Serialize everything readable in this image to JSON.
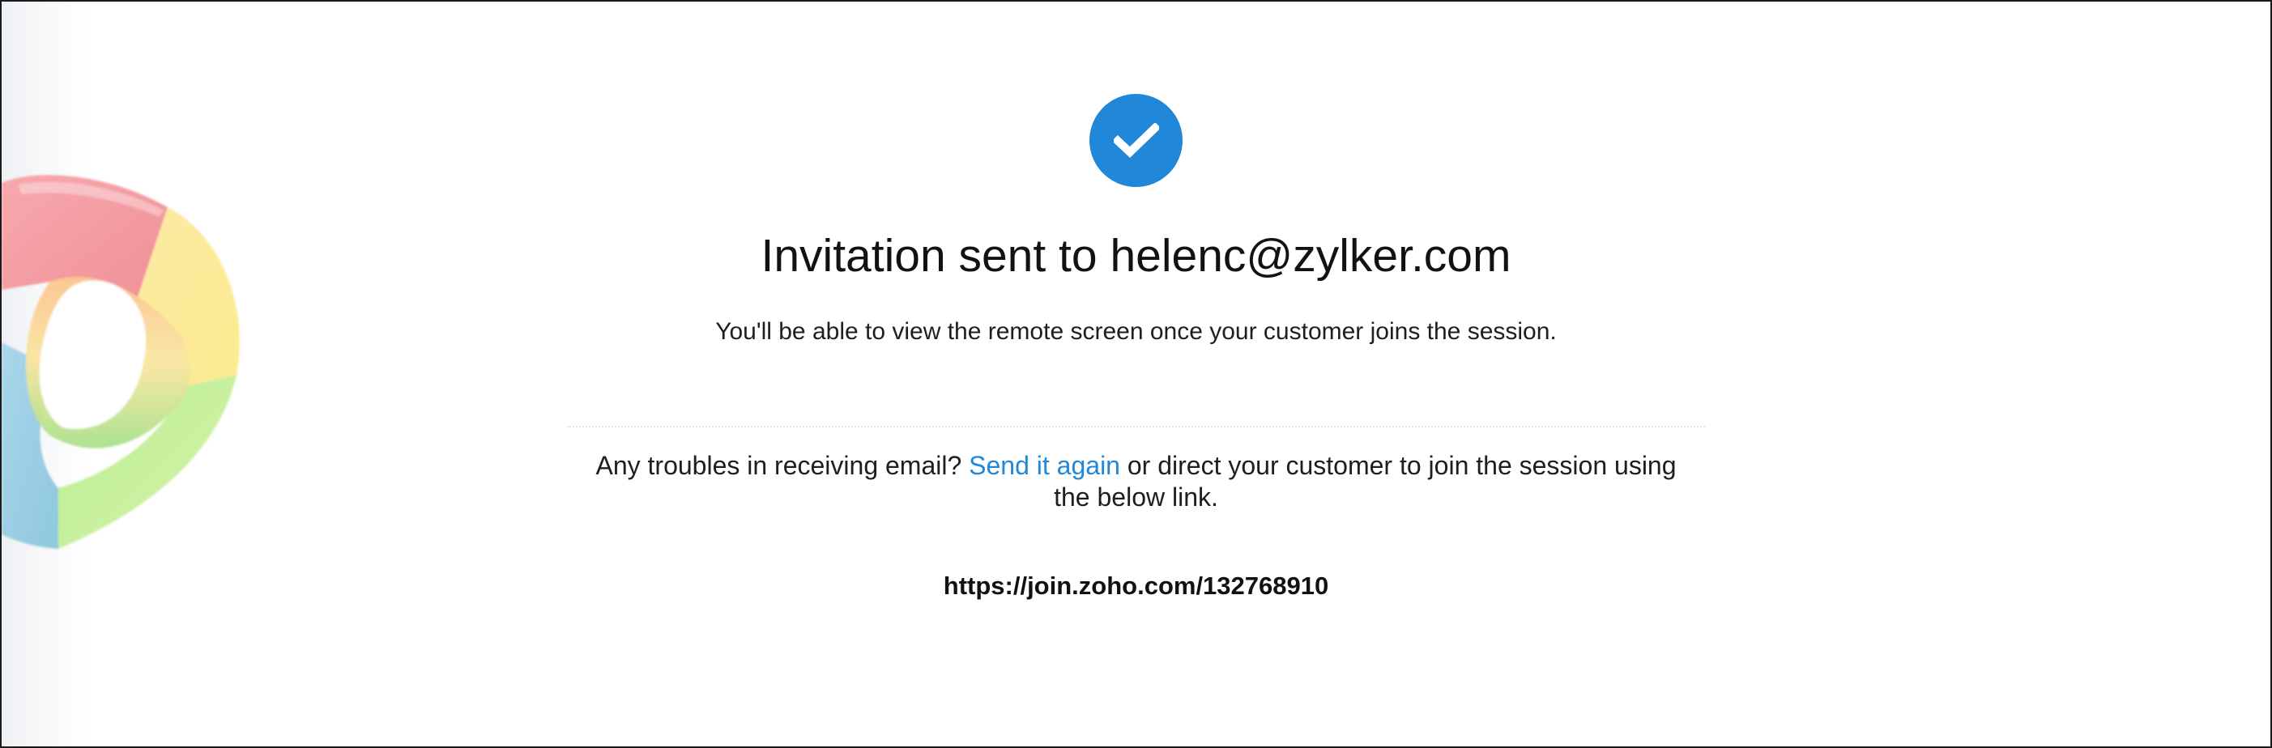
{
  "status": {
    "icon": "checkmark-icon",
    "accent_color": "#2187d8"
  },
  "headline": {
    "prefix": "Invitation sent to ",
    "email": "helenc@zylker.com"
  },
  "subtext": "You'll be able to view the remote screen once your customer joins the session.",
  "trouble": {
    "prefix": "Any troubles in receiving email? ",
    "resend_link": "Send it again",
    "suffix": " or direct your customer to join the session using the below link."
  },
  "join_url": "https://join.zoho.com/132768910",
  "decor": {
    "icon": "colorful-ring-logo-icon"
  }
}
